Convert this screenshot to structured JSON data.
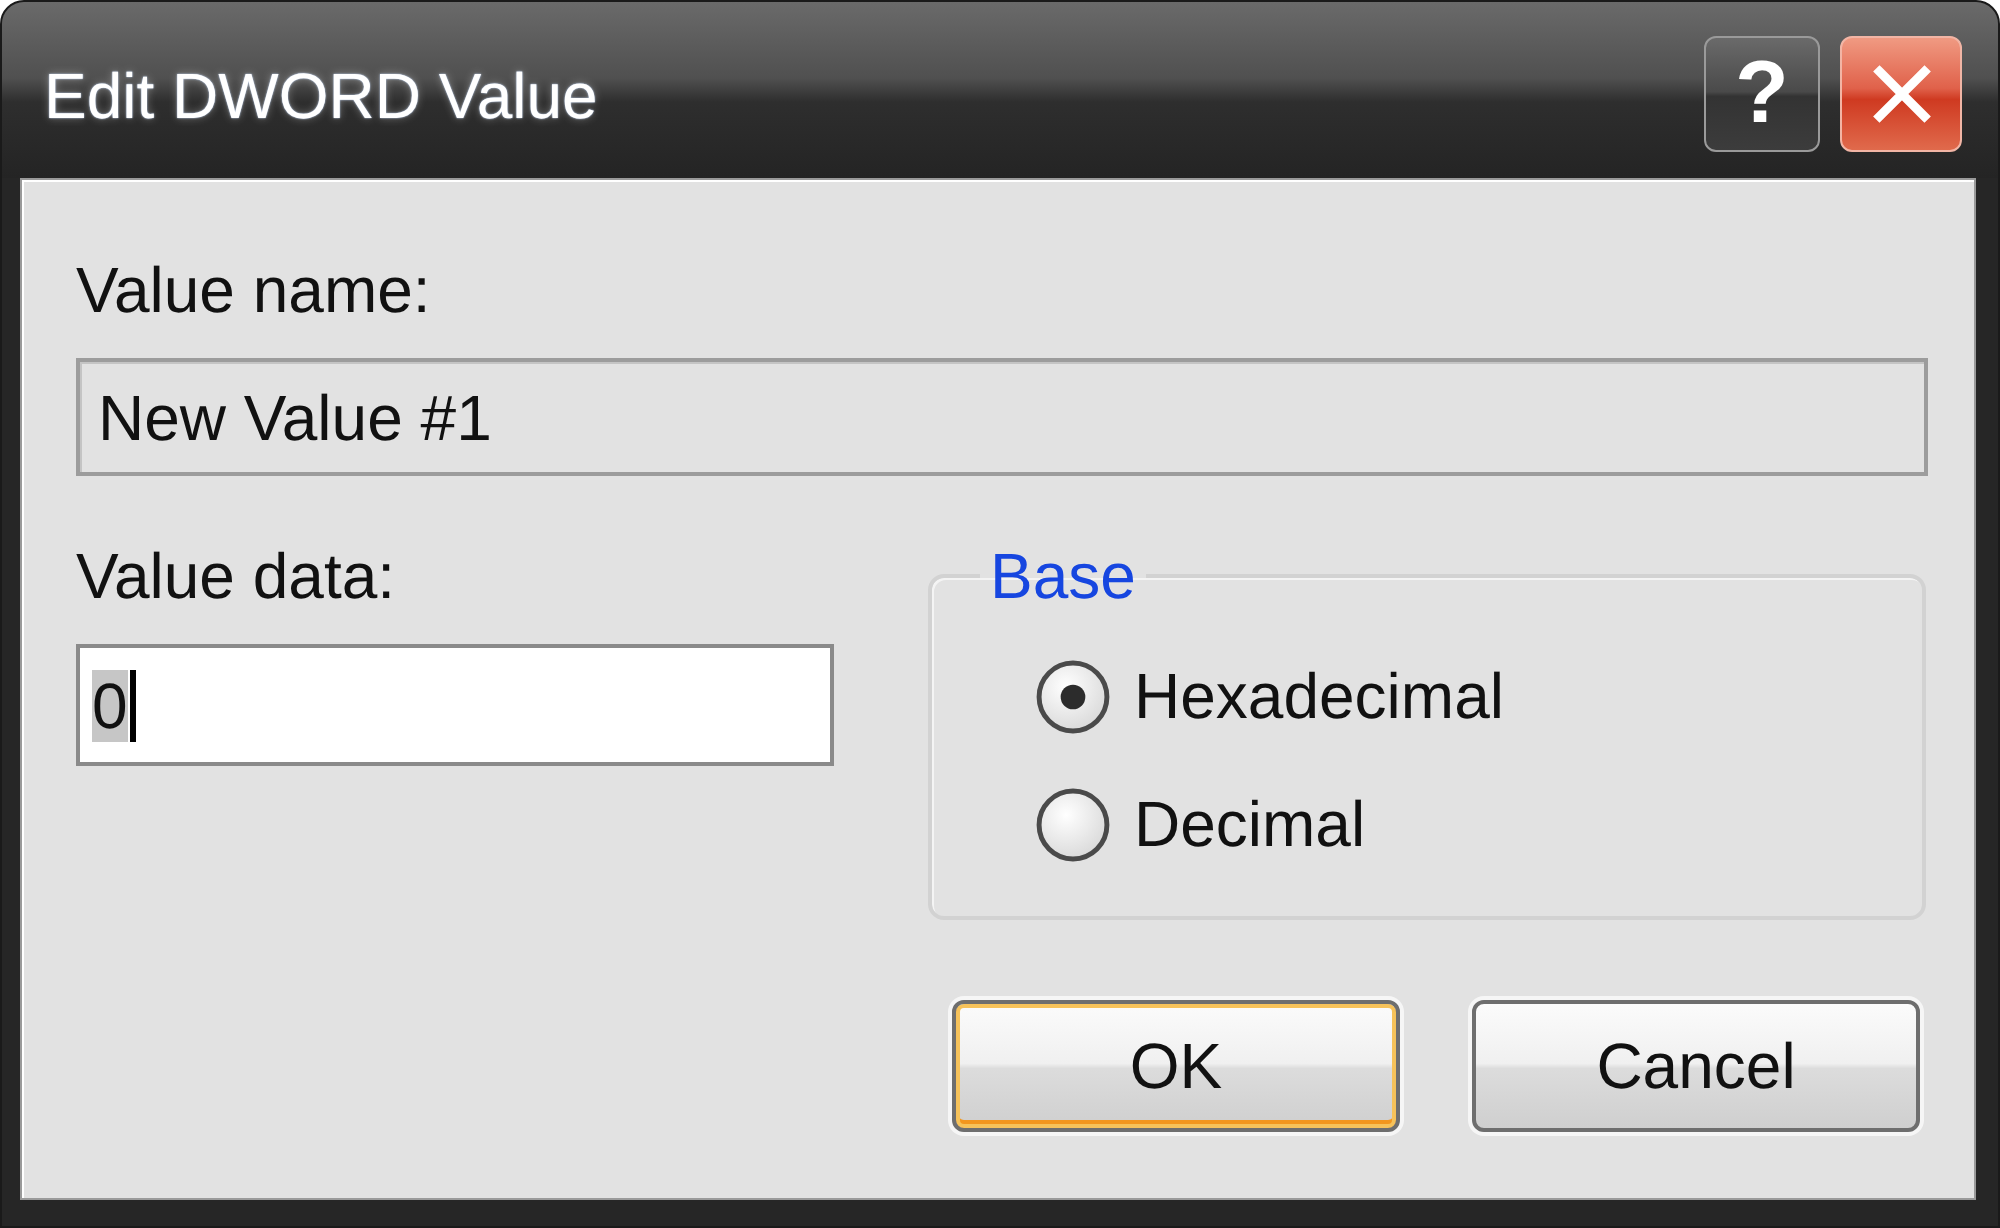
{
  "window": {
    "title": "Edit DWORD Value",
    "title_buttons": [
      {
        "kind": "help",
        "label": "?"
      },
      {
        "kind": "close"
      }
    ]
  },
  "value_name": {
    "label": "Value name:",
    "value": "New Value #1",
    "read_only": true
  },
  "value_data": {
    "label": "Value data:",
    "value": "0",
    "focused": true,
    "text_highlighted": true
  },
  "base": {
    "title": "Base",
    "options": [
      {
        "label": "Hexadecimal",
        "selected": true
      },
      {
        "label": "Decimal",
        "selected": false
      }
    ]
  },
  "buttons": [
    {
      "label": "OK",
      "default": true
    },
    {
      "label": "Cancel",
      "default": false
    }
  ]
}
